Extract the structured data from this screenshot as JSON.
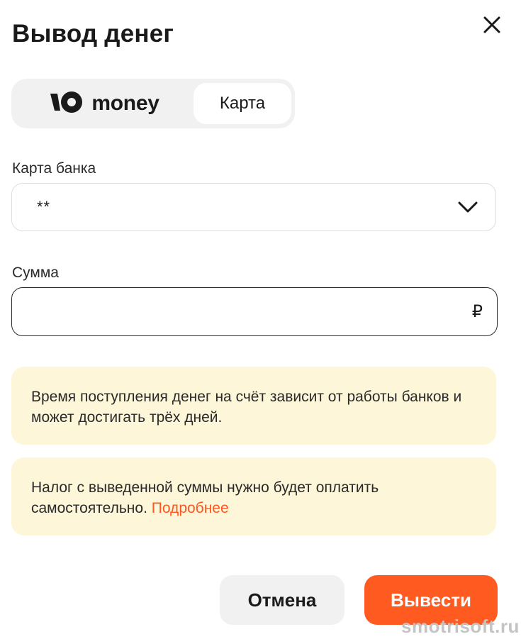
{
  "dialog": {
    "title": "Вывод денег",
    "close_icon": "close-icon"
  },
  "method_switch": {
    "yoomoney_logo_text": "money",
    "yoomoney_icon": "yoomoney-logo-icon",
    "card_label": "Карта",
    "selected": "Карта"
  },
  "bank_card": {
    "label": "Карта банка",
    "value": "**",
    "chevron_icon": "chevron-down-icon"
  },
  "amount": {
    "label": "Сумма",
    "value": "",
    "placeholder": "",
    "currency": "₽"
  },
  "notices": [
    {
      "text": "Время поступления денег на счёт зависит от работы банков и может достигать трёх дней."
    },
    {
      "text": "Налог с выведенной суммы нужно будет оплатить самостоятельно.",
      "link": "Подробнее"
    }
  ],
  "buttons": {
    "cancel": "Отмена",
    "withdraw": "Вывести"
  },
  "watermark": "smotrisoft.ru",
  "colors": {
    "accent": "#ff5a1f",
    "link": "#ff5722",
    "notice_bg": "#fdf6d8",
    "switch_bg": "#f1f1f1"
  }
}
